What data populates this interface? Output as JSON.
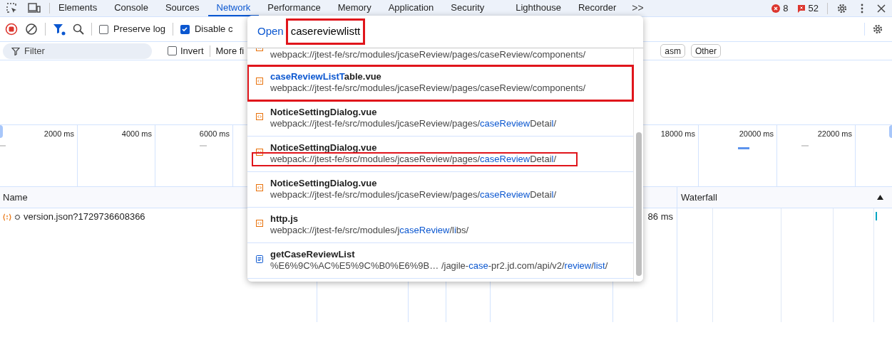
{
  "tabs": [
    {
      "label": "Elements",
      "selected": false
    },
    {
      "label": "Console",
      "selected": false
    },
    {
      "label": "Sources",
      "selected": false
    },
    {
      "label": "Network",
      "selected": true
    },
    {
      "label": "Performance",
      "selected": false
    },
    {
      "label": "Memory",
      "selected": false
    },
    {
      "label": "Application",
      "selected": false
    },
    {
      "label": "Security",
      "selected": false
    },
    {
      "label": "Lighthouse",
      "selected": false
    },
    {
      "label": "Recorder",
      "selected": false
    }
  ],
  "more_tabs": ">>",
  "errors": "8",
  "messages": "52",
  "toolbar": {
    "preserve_log": {
      "label": "Preserve log",
      "checked": false
    },
    "disable_cache": {
      "label": "Disable c",
      "checked": true
    }
  },
  "filter_bar": {
    "placeholder": "Filter",
    "invert": {
      "label": "Invert",
      "checked": false
    },
    "more_filters": "More fi",
    "chips": [
      "asm",
      "Other"
    ]
  },
  "overview": {
    "ticks_left": [
      "2000 ms",
      "4000 ms",
      "6000 ms"
    ],
    "ticks_right": [
      "18000 ms",
      "20000 ms",
      "22000 ms"
    ]
  },
  "table": {
    "columns": {
      "name": "Name",
      "waterfall": "Waterfall"
    },
    "rows": [
      {
        "name": "version.json?1729736608366",
        "time": "86 ms"
      }
    ]
  },
  "quick_open": {
    "prefix": "Open",
    "query": "casereviewlistt",
    "annotated": true,
    "items": [
      {
        "kind": "source",
        "path": [
          {
            "text": "webpack://jtest-fe/src/modules/jcaseReview/pages/caseReview/components/",
            "match": false
          }
        ],
        "boxed": false,
        "path_boxed": false
      },
      {
        "kind": "source",
        "name": [
          {
            "text": "caseReviewListT",
            "match": true
          },
          {
            "text": "able.vue",
            "match": false
          }
        ],
        "path": [
          {
            "text": "webpack://jtest-fe/src/modules/jcaseReview/pages/caseReview/components/",
            "match": false
          }
        ],
        "boxed": true,
        "path_boxed": false
      },
      {
        "kind": "source",
        "name": [
          {
            "text": "NoticeSettingDialog.vue",
            "match": false
          }
        ],
        "path": [
          {
            "text": "webpack://jtest-fe/src/modules/jcaseReview/pages/",
            "match": false
          },
          {
            "text": "caseReview",
            "match": true
          },
          {
            "text": "Detai",
            "match": false
          },
          {
            "text": "l",
            "match": true
          },
          {
            "text": "/",
            "match": false
          }
        ],
        "boxed": false,
        "path_boxed": false
      },
      {
        "kind": "source",
        "name": [
          {
            "text": "NoticeSettingDialog.vue",
            "match": false
          }
        ],
        "path": [
          {
            "text": "webpack://jtest-fe/src/modules/jcaseReview/pages/",
            "match": false
          },
          {
            "text": "caseReview",
            "match": true
          },
          {
            "text": "Detai",
            "match": false
          },
          {
            "text": "l",
            "match": true
          },
          {
            "text": "/",
            "match": false
          }
        ],
        "boxed": false,
        "path_boxed": true
      },
      {
        "kind": "source",
        "name": [
          {
            "text": "NoticeSettingDialog.vue",
            "match": false
          }
        ],
        "path": [
          {
            "text": "webpack://jtest-fe/src/modules/jcaseReview/pages/",
            "match": false
          },
          {
            "text": "caseReview",
            "match": true
          },
          {
            "text": "Detai",
            "match": false
          },
          {
            "text": "l",
            "match": true
          },
          {
            "text": "/",
            "match": false
          }
        ],
        "boxed": false,
        "path_boxed": false
      },
      {
        "kind": "source",
        "name": [
          {
            "text": "http.js",
            "match": false
          }
        ],
        "path": [
          {
            "text": "webpack://jtest-fe/src/modules/j",
            "match": false
          },
          {
            "text": "caseReview",
            "match": true
          },
          {
            "text": "/l",
            "match": false
          },
          {
            "text": "i",
            "match": true
          },
          {
            "text": "bs",
            "match": false
          },
          {
            "text": "/",
            "match": false
          }
        ],
        "boxed": false,
        "path_boxed": false
      },
      {
        "kind": "request",
        "name": [
          {
            "text": "getCaseReviewList",
            "match": false
          }
        ],
        "path": [
          {
            "text": "%E6%9C%AC%E5%9C%B0%E6%9B… /jagile-",
            "match": false
          },
          {
            "text": "case",
            "match": true
          },
          {
            "text": "-pr2.jd.com/api/v2/",
            "match": false
          },
          {
            "text": "review",
            "match": true
          },
          {
            "text": "/",
            "match": false
          },
          {
            "text": "list",
            "match": true
          },
          {
            "text": "/",
            "match": false
          }
        ],
        "boxed": false,
        "path_boxed": false
      }
    ]
  }
}
